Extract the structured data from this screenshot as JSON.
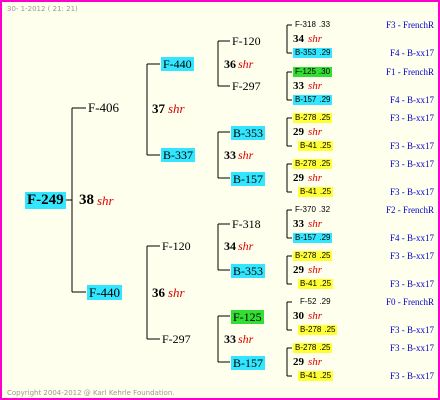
{
  "header": {
    "text": "30-  1-2012 ( 21: 21)"
  },
  "footer": {
    "text": "Copyright 2004-2012 @ Karl Kehrle Foundation."
  },
  "colors": {
    "frame": "#ff00cc",
    "background": "#ffffee",
    "cyan": "#33e6ff",
    "green": "#33dd33",
    "yellow": "#ffff33",
    "shr": "#dd0000",
    "org": "#0000cc"
  },
  "root": {
    "name": "F-249",
    "num": "38",
    "shr": "shr"
  },
  "gen1": [
    {
      "name": "F-406",
      "num": "37",
      "shr": "shr"
    },
    {
      "name": "F-440",
      "num": "36",
      "shr": "shr"
    }
  ],
  "gen2": [
    {
      "name": "F-440",
      "num": "36",
      "shr": "shr"
    },
    {
      "name": "B-337",
      "num": "33",
      "shr": "shr"
    },
    {
      "name": "F-120",
      "num": "34",
      "shr": "shr"
    },
    {
      "name": "F-297",
      "num": "33",
      "shr": "shr"
    }
  ],
  "gen3": [
    {
      "name": "F-120",
      "num": "34",
      "shr": "shr"
    },
    {
      "name": "F-297",
      "num": "33",
      "shr": "shr"
    },
    {
      "name": "B-353",
      "num": "29",
      "shr": "shr"
    },
    {
      "name": "B-157",
      "num": "29",
      "shr": "shr"
    },
    {
      "name": "F-318",
      "num": "33",
      "shr": "shr"
    },
    {
      "name": "B-353",
      "num": "29",
      "shr": "shr"
    },
    {
      "name": "F-125",
      "num": "30",
      "shr": "shr"
    },
    {
      "name": "B-157",
      "num": "29",
      "shr": "shr"
    }
  ],
  "gen4": [
    {
      "name": "F-318",
      "year": ".33",
      "org": "F3 - FrenchR"
    },
    {
      "name": "B-353",
      "year": ".29",
      "org": "F4 - B-xx17"
    },
    {
      "name": "F-125",
      "year": ".30",
      "org": "F1 - FrenchR"
    },
    {
      "name": "B-157",
      "year": ".29",
      "org": "F4 - B-xx17"
    },
    {
      "name": "B-278",
      "year": ".25",
      "org": "F3 - B-xx17"
    },
    {
      "name": "B-41",
      "year": ".25",
      "org": "F3 - B-xx17"
    },
    {
      "name": "B-278",
      "year": ".25",
      "org": "F3 - B-xx17"
    },
    {
      "name": "B-41",
      "year": ".25",
      "org": "F3 - B-xx17"
    },
    {
      "name": "F-370",
      "year": ".32",
      "org": "F2 - FrenchR"
    },
    {
      "name": "B-157",
      "year": ".29",
      "org": "F4 - B-xx17"
    },
    {
      "name": "B-278",
      "year": ".25",
      "org": "F3 - B-xx17"
    },
    {
      "name": "B-41",
      "year": ".25",
      "org": "F3 - B-xx17"
    },
    {
      "name": "F-52",
      "year": ".29",
      "org": "F0 - FrenchR"
    },
    {
      "name": "B-278",
      "year": ".25",
      "org": "F3 - B-xx17"
    },
    {
      "name": "B-278",
      "year": ".25",
      "org": "F3 - B-xx17"
    },
    {
      "name": "B-41",
      "year": ".25",
      "org": "F3 - B-xx17"
    }
  ]
}
